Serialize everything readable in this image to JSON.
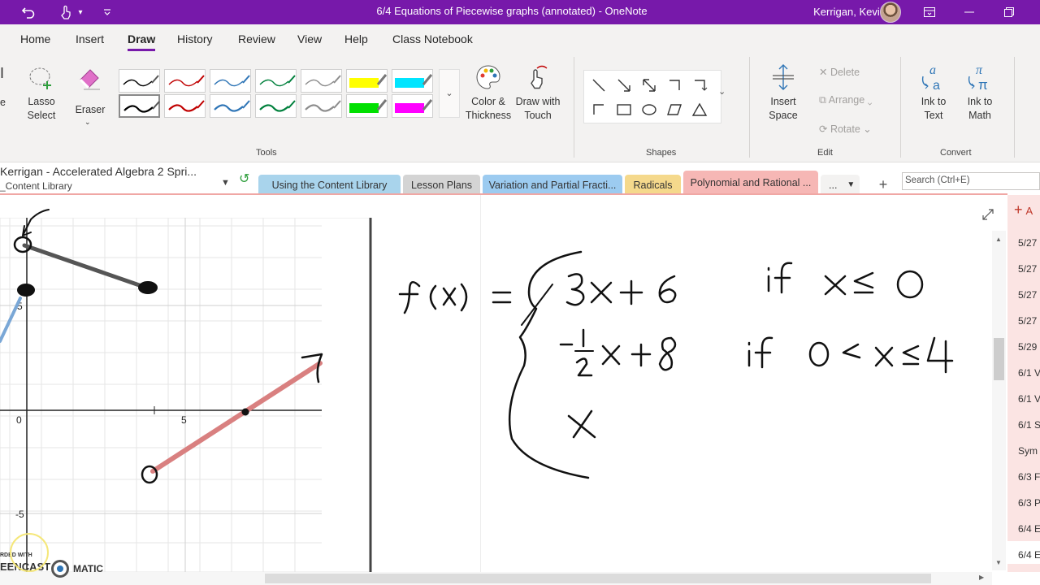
{
  "titlebar": {
    "doc_title": "6/4 Equations of Piecewise graphs (annotated)  -  OneNote",
    "user_name": "Kerrigan, Kevin",
    "undo_icon": "undo-icon",
    "touch_icon": "touch-mode-icon",
    "customize_icon": "customize-quick-access-icon"
  },
  "menu": {
    "tabs": [
      "Home",
      "Insert",
      "Draw",
      "History",
      "Review",
      "View",
      "Help",
      "Class Notebook"
    ],
    "active": "Draw"
  },
  "ribbon": {
    "type_label": "e",
    "lasso_label_1": "Lasso",
    "lasso_label_2": "Select",
    "eraser_label": "Eraser",
    "color_thickness_1": "Color &",
    "color_thickness_2": "Thickness",
    "draw_touch_1": "Draw with",
    "draw_touch_2": "Touch",
    "tools_group": "Tools",
    "shapes_group": "Shapes",
    "insert_space_1": "Insert",
    "insert_space_2": "Space",
    "delete_label": "Delete",
    "arrange_label": "Arrange",
    "rotate_label": "Rotate",
    "edit_group": "Edit",
    "ink_text_1": "Ink to",
    "ink_text_2": "Text",
    "ink_math_1": "Ink to",
    "ink_math_2": "Math",
    "convert_group": "Convert",
    "pen_colors": [
      "#000000",
      "#c00000",
      "#2e75b6",
      "#00803c",
      "#8c8c8c",
      "#ffff00",
      "#00e5ff"
    ],
    "pen_colors_row2": [
      "#000000",
      "#c00000",
      "#2e75b6",
      "#00803c",
      "#8c8c8c",
      "#00e000",
      "#ff00ff"
    ]
  },
  "sectionbar": {
    "notebook": "Kerrigan - Accelerated Algebra 2 Spri...",
    "notebook_sub": "_Content Library",
    "tabs": [
      {
        "label": "Using the Content Library",
        "color": "#a9d4ec"
      },
      {
        "label": "Lesson Plans",
        "color": "#d4d4d4"
      },
      {
        "label": "Variation and Partial Fracti...",
        "color": "#9ccbf0"
      },
      {
        "label": "Radicals",
        "color": "#f5d98c"
      },
      {
        "label": "Polynomial and Rational ...",
        "color": "#f6b7b5"
      }
    ],
    "more": "...",
    "add": "+",
    "search_placeholder": "Search (Ctrl+E)"
  },
  "pages": {
    "add_label": "A",
    "items": [
      "5/27",
      "5/27",
      "5/27",
      "5/27",
      "5/29",
      "6/1 V",
      "6/1 V",
      "6/1 S",
      "Sym",
      "6/3 F",
      "6/3 P",
      "6/4 E",
      "6/4 E"
    ]
  },
  "graph": {
    "tick_0": "0",
    "tick_5": "5",
    "tick_5_y": "5",
    "tick_neg5": "-5"
  },
  "recorder": {
    "line1": "RDED WITH",
    "line2": "EENCAST",
    "line3": "MATIC"
  }
}
